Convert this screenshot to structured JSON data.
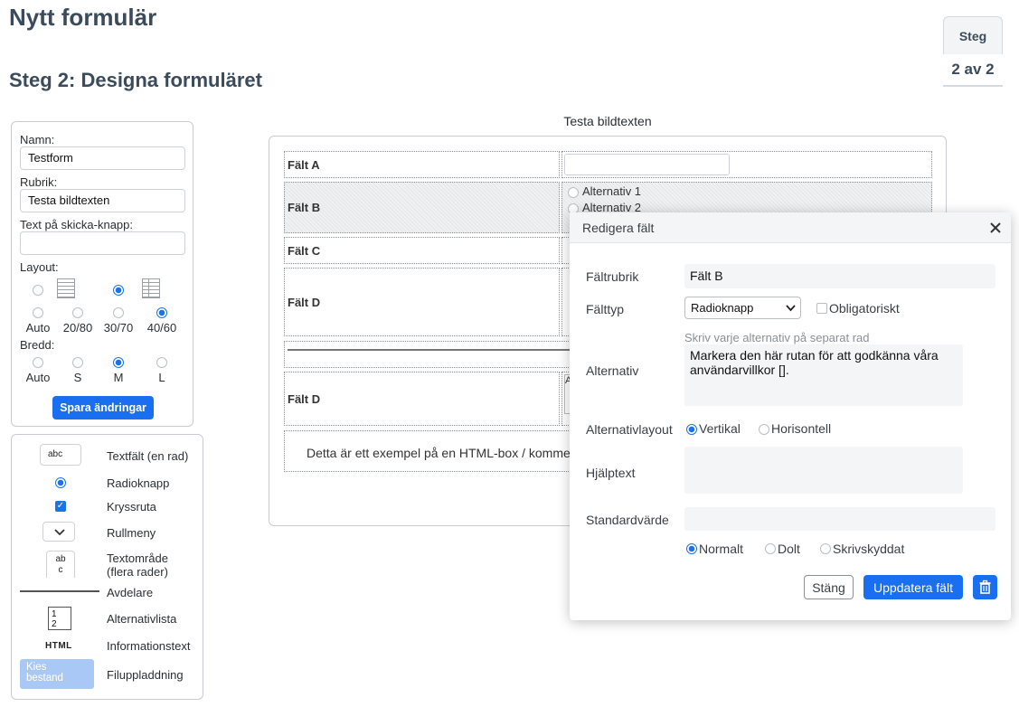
{
  "page": {
    "title": "Nytt formulär",
    "step_heading": "Steg 2: Designa formuläret"
  },
  "step_indicator": {
    "label": "Steg",
    "value": "2 av 2"
  },
  "settings": {
    "name_label": "Namn:",
    "name_value": "Testform",
    "rubric_label": "Rubrik:",
    "rubric_value": "Testa bildtexten",
    "submit_label": "Text på skicka-knapp:",
    "submit_value": "",
    "layout_label": "Layout:",
    "layout_options": [
      "Auto",
      "20/80",
      "30/70",
      "40/60"
    ],
    "width_label": "Bredd:",
    "width_options": [
      "Auto",
      "S",
      "M",
      "L"
    ],
    "save_button": "Spara ändringar"
  },
  "palette": {
    "items": [
      {
        "label": "Textfält (en rad)",
        "sample": "abc",
        "icon": "textfield-icon"
      },
      {
        "label": "Radioknapp",
        "icon": "radio-icon"
      },
      {
        "label": "Kryssruta",
        "icon": "checkbox-icon"
      },
      {
        "label": "Rullmeny",
        "icon": "chevron-down-icon"
      },
      {
        "label": "Textområde (flera rader)",
        "label_line1": "Textområde",
        "label_line2": "(flera rader)",
        "sample_line1": "ab",
        "sample_line2": "c",
        "icon": "textarea-icon"
      },
      {
        "label": "Avdelare",
        "icon": "divider-icon"
      },
      {
        "label": "Alternativlista",
        "sample_line1": "1",
        "sample_line2": "2",
        "icon": "list-icon"
      },
      {
        "label": "Informationstext",
        "sample": "HTML",
        "icon": "html-icon"
      },
      {
        "label": "Filuppladdning",
        "sample_line1": "Kies",
        "sample_line2": "bestand",
        "icon": "upload-icon"
      }
    ]
  },
  "preview": {
    "caption": "Testa bildtexten",
    "fields": {
      "a": "Fält A",
      "b": "Fält B",
      "b_options": [
        "Alternativ 1",
        "Alternativ 2"
      ],
      "c": "Fält C",
      "d1": "Fält D",
      "d2": "Fält D",
      "d2_prefix": "A",
      "html_text": "Detta är ett exempel på en HTML-box / komme"
    }
  },
  "modal": {
    "title": "Redigera fält",
    "field_title_label": "Fältrubrik",
    "field_title_value": "Fält B",
    "field_type_label": "Fälttyp",
    "field_type_value": "Radioknapp",
    "required_label": "Obligatoriskt",
    "options_hint": "Skriv varje alternativ på separat rad",
    "options_label": "Alternativ",
    "options_value": "Markera den här rutan för att godkänna våra användarvillkor [].",
    "layout_label": "Alternativlayout",
    "layout_options": [
      "Vertikal",
      "Horisontell"
    ],
    "help_label": "Hjälptext",
    "help_value": "",
    "default_label": "Standardvärde",
    "default_value": "",
    "mode_options": [
      "Normalt",
      "Dolt",
      "Skrivskyddat"
    ],
    "close_button": "Stäng",
    "update_button": "Uppdatera fält"
  },
  "colors": {
    "accent": "#1a6ff0",
    "heading": "#3c4b5c"
  }
}
